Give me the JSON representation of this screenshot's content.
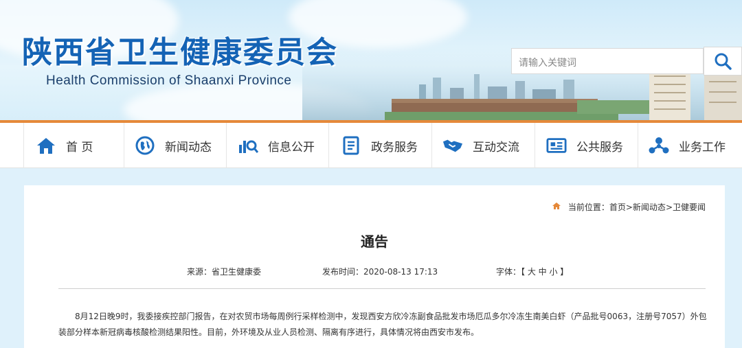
{
  "header": {
    "title_cn": "陕西省卫生健康委员会",
    "title_en": "Health Commission of Shaanxi Province",
    "search_placeholder": "请输入关键词"
  },
  "nav": {
    "items": [
      {
        "label": "首 页",
        "icon": "home-icon"
      },
      {
        "label": "新闻动态",
        "icon": "globe-icon"
      },
      {
        "label": "信息公开",
        "icon": "chart-search-icon"
      },
      {
        "label": "政务服务",
        "icon": "document-list-icon"
      },
      {
        "label": "互动交流",
        "icon": "handshake-icon"
      },
      {
        "label": "公共服务",
        "icon": "newspaper-icon"
      },
      {
        "label": "业务工作",
        "icon": "network-icon"
      }
    ]
  },
  "breadcrumb": {
    "prefix": "当前位置：",
    "items": [
      "首页",
      ">新闻动态",
      ">卫健要闻"
    ]
  },
  "article": {
    "title": "通告",
    "source": "来源：省卫生健康委",
    "publish_time": "发布时间：2020-08-13 17:13",
    "font_size_label": "字体：【 大 中 小 】",
    "paragraph": "8月12日晚9时，我委接疾控部门报告，在对农贸市场每周例行采样检测中，发现西安方欣冷冻副食品批发市场厄瓜多尔冷冻生南美白虾（产品批号0063，注册号7057）外包装部分样本新冠病毒核酸检测结果阳性。目前，外环境及从业人员检测、隔离有序进行，具体情况将由西安市发布。"
  },
  "colors": {
    "brand_blue": "#1463b5",
    "accent_orange": "#e5893a",
    "icon_blue": "#1f6fc0"
  }
}
